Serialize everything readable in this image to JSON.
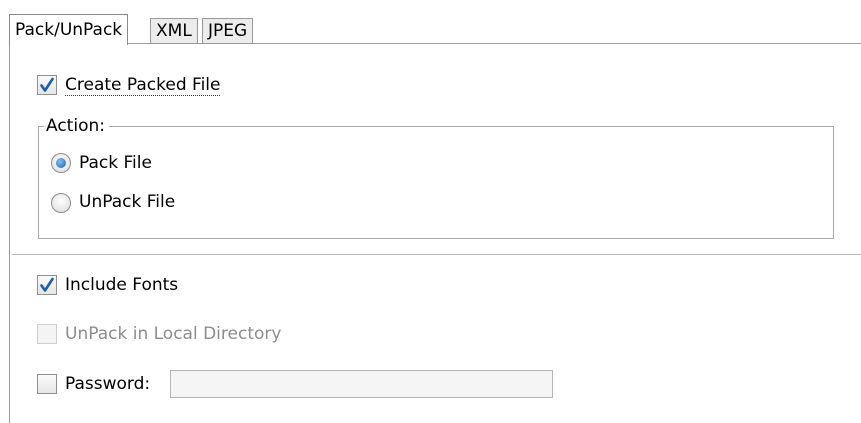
{
  "tabs": [
    {
      "label": "Pack/UnPack",
      "selected": true
    },
    {
      "label": "XML",
      "selected": false
    },
    {
      "label": "JPEG",
      "selected": false
    }
  ],
  "create_packed_file": {
    "label": "Create Packed File",
    "checked": true
  },
  "action_group": {
    "legend": "Action:",
    "options": [
      {
        "label": "Pack File",
        "selected": true
      },
      {
        "label": "UnPack File",
        "selected": false
      }
    ]
  },
  "include_fonts": {
    "label": "Include Fonts",
    "checked": true
  },
  "unpack_local": {
    "label": "UnPack in Local Directory",
    "checked": false,
    "disabled": true
  },
  "password": {
    "label": "Password:",
    "checked": false,
    "value": ""
  },
  "colors": {
    "check_mark": "#1f5fa8",
    "radio_dot": "#1f5fa8",
    "disabled_text": "#8d8d8d"
  },
  "icons": {
    "check": "check-mark-icon",
    "radio": "radio-dot-icon"
  }
}
